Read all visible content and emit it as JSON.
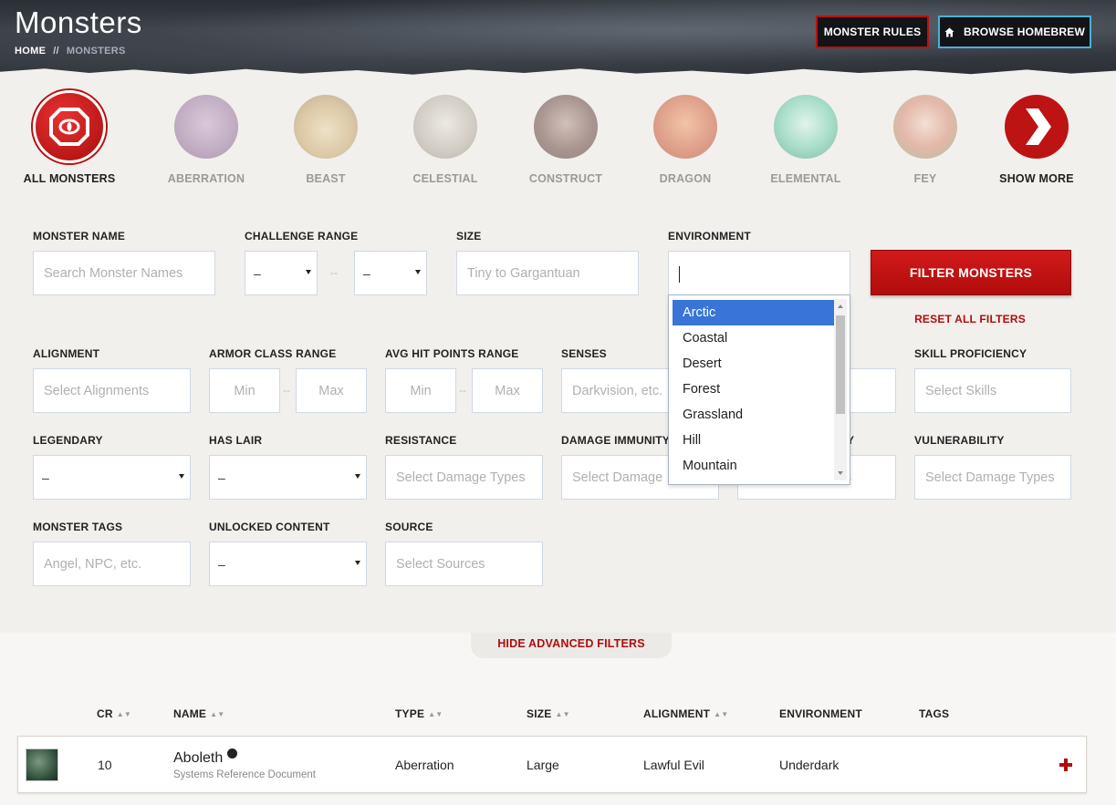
{
  "header": {
    "title": "Monsters",
    "breadcrumb": {
      "home": "HOME",
      "separator": "//",
      "current": "MONSTERS"
    },
    "buttons": {
      "rules": "MONSTER RULES",
      "homebrew": "BROWSE HOMEBREW"
    }
  },
  "types": [
    {
      "label": "ALL MONSTERS",
      "active": true
    },
    {
      "label": "ABERRATION"
    },
    {
      "label": "BEAST"
    },
    {
      "label": "CELESTIAL"
    },
    {
      "label": "CONSTRUCT"
    },
    {
      "label": "DRAGON"
    },
    {
      "label": "ELEMENTAL"
    },
    {
      "label": "FEY"
    },
    {
      "label": "SHOW MORE"
    }
  ],
  "filters": {
    "monster_name": {
      "label": "MONSTER NAME",
      "placeholder": "Search Monster Names"
    },
    "challenge_range": {
      "label": "CHALLENGE RANGE",
      "min": "–",
      "max": "–",
      "separator": "--"
    },
    "size": {
      "label": "SIZE",
      "placeholder": "Tiny to Gargantuan"
    },
    "environment": {
      "label": "ENVIRONMENT",
      "options": [
        "Arctic",
        "Coastal",
        "Desert",
        "Forest",
        "Grassland",
        "Hill",
        "Mountain"
      ],
      "highlighted": "Arctic"
    },
    "filter_button": "FILTER MONSTERS",
    "reset_link": "RESET ALL FILTERS",
    "alignment": {
      "label": "ALIGNMENT",
      "placeholder": "Select Alignments"
    },
    "armor_class": {
      "label": "ARMOR CLASS RANGE",
      "min": "Min",
      "max": "Max"
    },
    "hit_points": {
      "label": "AVG HIT POINTS RANGE",
      "min": "Min",
      "max": "Max"
    },
    "senses": {
      "label": "SENSES",
      "placeholder": "Darkvision, etc."
    },
    "skill": {
      "label": "SKILL PROFICIENCY",
      "placeholder": "Select Skills"
    },
    "legendary": {
      "label": "LEGENDARY",
      "value": "–"
    },
    "has_lair": {
      "label": "HAS LAIR",
      "value": "–"
    },
    "resistance": {
      "label": "RESISTANCE",
      "placeholder": "Select Damage Types"
    },
    "damage_immunity": {
      "label": "DAMAGE IMMUNITY",
      "placeholder": "Select Damage"
    },
    "condition_immunity": {
      "label_tail": "Y",
      "placeholder_tail": "s"
    },
    "vulnerability": {
      "label": "VULNERABILITY",
      "placeholder": "Select Damage Types"
    },
    "monster_tags": {
      "label": "MONSTER TAGS",
      "placeholder": "Angel, NPC, etc."
    },
    "unlocked_content": {
      "label": "UNLOCKED CONTENT",
      "value": "–"
    },
    "source": {
      "label": "SOURCE",
      "placeholder": "Select Sources"
    },
    "hide_advanced": "HIDE ADVANCED FILTERS"
  },
  "table": {
    "columns": {
      "cr": "CR",
      "name": "NAME",
      "type": "TYPE",
      "size": "SIZE",
      "alignment": "ALIGNMENT",
      "environment": "ENVIRONMENT",
      "tags": "TAGS"
    },
    "rows": [
      {
        "cr": "10",
        "name": "Aboleth",
        "source": "Systems Reference Document",
        "type": "Aberration",
        "size": "Large",
        "alignment": "Lawful Evil",
        "environment": "Underdark"
      }
    ]
  },
  "colors": {
    "accent_red": "#b10c0c",
    "homebrew_border": "#47b2d6",
    "dropdown_highlight": "#3875d7"
  }
}
